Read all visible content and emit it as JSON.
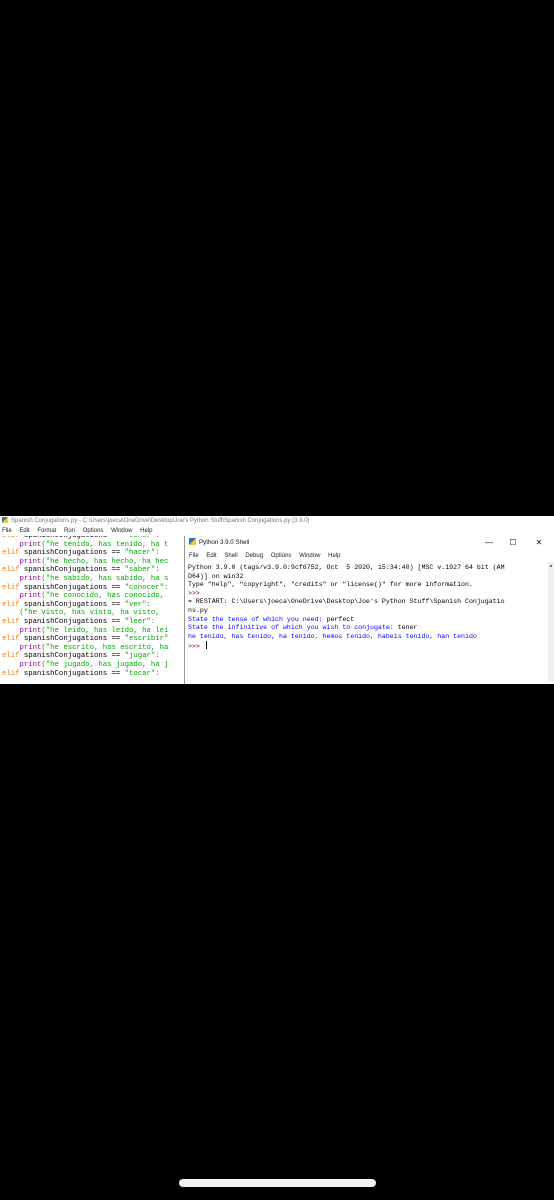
{
  "editor": {
    "title": "Spanish Conjugations.py - C:\\Users\\joeca\\OneDrive\\Desktop\\Joe's Python Stuff\\Spanish Conjugations.py (3.9.0)",
    "menu": [
      "File",
      "Edit",
      "Format",
      "Run",
      "Options",
      "Window",
      "Help"
    ],
    "code_lines": [
      [
        {
          "t": "kw",
          "v": "elif "
        },
        {
          "t": "",
          "v": "spanishConjugations "
        },
        {
          "t": "",
          "v": "== "
        },
        {
          "t": "st",
          "v": "\"tener\":"
        }
      ],
      [
        {
          "t": "",
          "v": "    "
        },
        {
          "t": "bi",
          "v": "print"
        },
        {
          "t": "st",
          "v": "(\"he tenido, has tenido, ha t"
        }
      ],
      [
        {
          "t": "kw",
          "v": "elif "
        },
        {
          "t": "",
          "v": "spanishConjugations == "
        },
        {
          "t": "st",
          "v": "\"hacer\":"
        }
      ],
      [
        {
          "t": "",
          "v": "    "
        },
        {
          "t": "bi",
          "v": "print"
        },
        {
          "t": "st",
          "v": "(\"he hecho, has hecho, ha hec"
        }
      ],
      [
        {
          "t": "kw",
          "v": "elif "
        },
        {
          "t": "",
          "v": "spanishConjugations == "
        },
        {
          "t": "st",
          "v": "\"saber\":"
        }
      ],
      [
        {
          "t": "",
          "v": "    "
        },
        {
          "t": "bi",
          "v": "print"
        },
        {
          "t": "st",
          "v": "(\"he sabido, has sabido, ha s"
        }
      ],
      [
        {
          "t": "kw",
          "v": "elif "
        },
        {
          "t": "",
          "v": "spanishConjugations == "
        },
        {
          "t": "st",
          "v": "\"conocer\":"
        }
      ],
      [
        {
          "t": "",
          "v": "    "
        },
        {
          "t": "bi",
          "v": "print"
        },
        {
          "t": "st",
          "v": "(\"he conocido, has conocido,"
        }
      ],
      [
        {
          "t": "kw",
          "v": "elif "
        },
        {
          "t": "",
          "v": "spanishConjugations == "
        },
        {
          "t": "st",
          "v": "\"ver\":"
        }
      ],
      [
        {
          "t": "",
          "v": "    "
        },
        {
          "t": "st",
          "v": "(\"he visto, has visto, ha visto,"
        }
      ],
      [
        {
          "t": "kw",
          "v": "elif "
        },
        {
          "t": "",
          "v": "spanishConjugations == "
        },
        {
          "t": "st",
          "v": "\"leer\":"
        }
      ],
      [
        {
          "t": "",
          "v": "    "
        },
        {
          "t": "bi",
          "v": "print"
        },
        {
          "t": "st",
          "v": "(\"he leido, has leido, ha lei"
        }
      ],
      [
        {
          "t": "kw",
          "v": "elif "
        },
        {
          "t": "",
          "v": "spanishConjugations == "
        },
        {
          "t": "st",
          "v": "\"escribir\""
        }
      ],
      [
        {
          "t": "",
          "v": "    "
        },
        {
          "t": "bi",
          "v": "print"
        },
        {
          "t": "st",
          "v": "(\"he escrito, has escrito, ha"
        }
      ],
      [
        {
          "t": "kw",
          "v": "elif "
        },
        {
          "t": "",
          "v": "spanishConjugations == "
        },
        {
          "t": "st",
          "v": "\"jugar\":"
        }
      ],
      [
        {
          "t": "",
          "v": "    "
        },
        {
          "t": "bi",
          "v": "print"
        },
        {
          "t": "st",
          "v": "(\"he jugado, has jugado, ha j"
        }
      ],
      [
        {
          "t": "kw",
          "v": "elif "
        },
        {
          "t": "",
          "v": "spanishConjugations == "
        },
        {
          "t": "st",
          "v": "\"tocar\":"
        }
      ]
    ]
  },
  "shell": {
    "title": "Python 3.9.0 Shell",
    "minimize_glyph": "—",
    "maximize_glyph": "☐",
    "close_glyph": "✕",
    "menu": [
      "File",
      "Edit",
      "Shell",
      "Debug",
      "Options",
      "Window",
      "Help"
    ],
    "lines": [
      {
        "cls": "",
        "text": "Python 3.9.0 (tags/v3.9.0:9cf6752, Oct  5 2020, 15:34:40) [MSC v.1927 64 bit (AM"
      },
      {
        "cls": "",
        "text": "D64)] on win32"
      },
      {
        "cls": "",
        "text": "Type \"help\", \"copyright\", \"credits\" or \"license()\" for more information."
      },
      {
        "cls": "prompt",
        "text": ">>>"
      },
      {
        "cls": "",
        "text": "= RESTART: C:\\Users\\joeca\\OneDrive\\Desktop\\Joe's Python Stuff\\Spanish Conjugatio"
      },
      {
        "cls": "",
        "text": "ns.py"
      },
      {
        "cls": "out",
        "text": "State the tense of which you need: ",
        "input": "perfect"
      },
      {
        "cls": "out",
        "text": "State the infinitive of which you wish to conjugate: ",
        "input": "tener"
      },
      {
        "cls": "out",
        "text": "he tenido, has tenido, ha tenido, hemos tenido, habeis tenido, han tenido"
      },
      {
        "cls": "prompt",
        "text": ">>> ",
        "cursor": true
      }
    ]
  }
}
